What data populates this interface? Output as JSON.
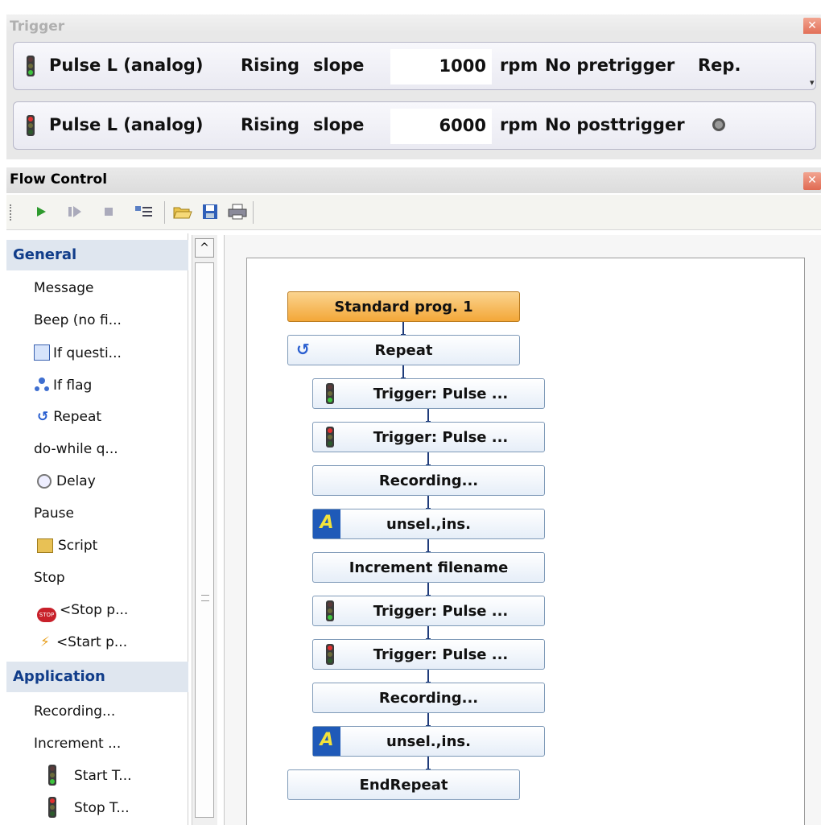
{
  "trigger_panel": {
    "title": "Trigger",
    "rows": [
      {
        "source": "Pulse L (analog)",
        "edge": "Rising",
        "mode": "slope",
        "value": "1000",
        "unit": "rpm",
        "option": "No pretrigger",
        "extra": "Rep."
      },
      {
        "source": "Pulse L (analog)",
        "edge": "Rising",
        "mode": "slope",
        "value": "6000",
        "unit": "rpm",
        "option": "No posttrigger",
        "extra": ""
      }
    ]
  },
  "flow_panel": {
    "title": "Flow Control",
    "toolbar": [
      "play-icon",
      "step-icon",
      "stop-icon",
      "list-icon",
      "open-folder-icon",
      "save-icon",
      "print-icon"
    ],
    "sidebar": {
      "general_header": "General",
      "general_items": [
        "Message",
        "Beep (no fi...",
        "If questi...",
        "If flag",
        "Repeat",
        "do-while q...",
        "Delay",
        "Pause",
        "Script",
        "Stop",
        "<Stop p...",
        "<Start p..."
      ],
      "application_header": "Application",
      "application_items": [
        "Recording...",
        "Increment ...",
        "Start T...",
        "Stop T..."
      ]
    },
    "nodes": [
      "Standard prog. 1",
      "Repeat",
      "Trigger: Pulse ...",
      "Trigger: Pulse ...",
      "Recording...",
      "unsel.,ins.",
      "Increment filename",
      "Trigger: Pulse ...",
      "Trigger: Pulse ...",
      "Recording...",
      "unsel.,ins.",
      "EndRepeat"
    ]
  }
}
